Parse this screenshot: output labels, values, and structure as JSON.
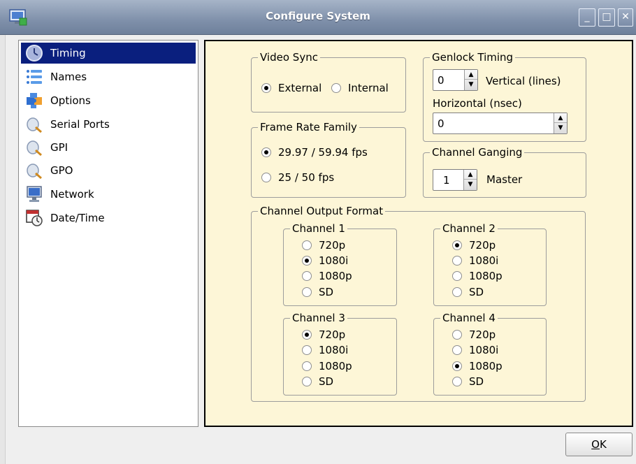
{
  "window": {
    "title": "Configure System",
    "minimize": "_",
    "maximize": "□",
    "close": "✕"
  },
  "sidebar": {
    "items": [
      {
        "label": "Timing",
        "icon": "clock-icon",
        "selected": true
      },
      {
        "label": "Names",
        "icon": "list-icon",
        "selected": false
      },
      {
        "label": "Options",
        "icon": "puzzle-icon",
        "selected": false
      },
      {
        "label": "Serial Ports",
        "icon": "plug-icon",
        "selected": false
      },
      {
        "label": "GPI",
        "icon": "plug-icon",
        "selected": false
      },
      {
        "label": "GPO",
        "icon": "plug-icon",
        "selected": false
      },
      {
        "label": "Network",
        "icon": "monitor-icon",
        "selected": false
      },
      {
        "label": "Date/Time",
        "icon": "calendar-clock-icon",
        "selected": false
      }
    ]
  },
  "timing": {
    "video_sync": {
      "title": "Video Sync",
      "options": [
        "External",
        "Internal"
      ],
      "selected": "External"
    },
    "frame_rate": {
      "title": "Frame Rate Family",
      "options": [
        "29.97 / 59.94 fps",
        "25 / 50 fps"
      ],
      "selected": "29.97 / 59.94 fps"
    },
    "genlock": {
      "title": "Genlock Timing",
      "vertical_value": "0",
      "vertical_label": "Vertical (lines)",
      "horizontal_label": "Horizontal (nsec)",
      "horizontal_value": "0"
    },
    "ganging": {
      "title": "Channel Ganging",
      "value": "1",
      "label": "Master"
    },
    "output_format": {
      "title": "Channel Output Format",
      "channels": [
        {
          "title": "Channel 1",
          "options": [
            "720p",
            "1080i",
            "1080p",
            "SD"
          ],
          "selected": "1080i"
        },
        {
          "title": "Channel 2",
          "options": [
            "720p",
            "1080i",
            "1080p",
            "SD"
          ],
          "selected": "720p"
        },
        {
          "title": "Channel 3",
          "options": [
            "720p",
            "1080i",
            "1080p",
            "SD"
          ],
          "selected": "720p"
        },
        {
          "title": "Channel 4",
          "options": [
            "720p",
            "1080i",
            "1080p",
            "SD"
          ],
          "selected": "1080p"
        }
      ]
    }
  },
  "buttons": {
    "ok_prefix": "",
    "ok_mnemonic": "O",
    "ok_rest": "K"
  },
  "colors": {
    "selection": "#0a1f7e",
    "panel_bg": "#fdf6d7",
    "titlebar": "#7f90aa"
  }
}
